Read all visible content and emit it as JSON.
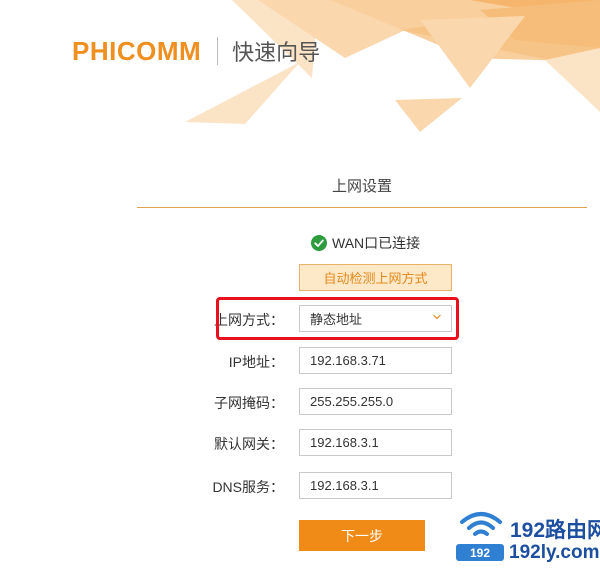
{
  "brand": {
    "logo": "PHICOMM",
    "title": "快速向导"
  },
  "section": {
    "title": "上网设置"
  },
  "status": {
    "text": "WAN口已连接",
    "icon": "check-circle-icon",
    "color": "#2e9b3f"
  },
  "detect_button": {
    "label": "自动检测上网方式"
  },
  "form": {
    "connection_type": {
      "label": "上网方式：",
      "value": "静态地址"
    },
    "ip": {
      "label": "IP地址：",
      "value": "192.168.3.71"
    },
    "subnet": {
      "label": "子网掩码：",
      "value": "255.255.255.0"
    },
    "gateway": {
      "label": "默认网关：",
      "value": "192.168.3.1"
    },
    "dns": {
      "label": "DNS服务：",
      "value": "192.168.3.1"
    }
  },
  "next_button": {
    "label": "下一步"
  },
  "watermark": {
    "title": "192路由网",
    "badge": "192",
    "url": "192ly.com"
  },
  "colors": {
    "accent": "#ef8b16",
    "highlight": "#e8111c",
    "watermark": "#1d4fa0"
  }
}
